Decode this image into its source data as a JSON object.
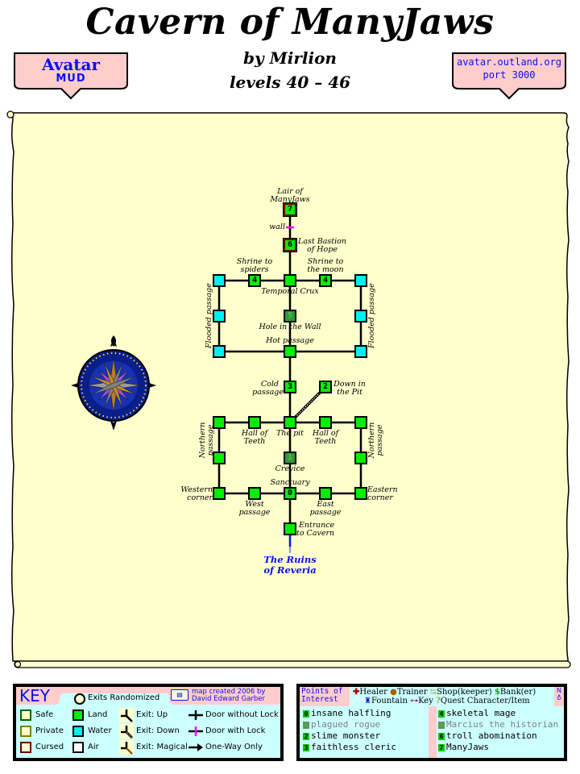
{
  "header": {
    "title": "Cavern of ManyJaws",
    "byline": "by Mirlion",
    "levels": "levels 40 – 46",
    "left_shield": {
      "line1": "Avatar",
      "line2": "MUD",
      "fill": "#ffcccc"
    },
    "right_shield": {
      "line1": "avatar.outland.org",
      "line2": "port 3000",
      "fill": "#ffcccc"
    }
  },
  "colors": {
    "parchment": "#ffffcc",
    "land": "#00ee00",
    "water": "#00f0f0",
    "cursed_border": "#6b0000",
    "door_with_lock": "#ff00ff",
    "exit_label": "#0a10f0",
    "legend_bg": "#ccffff",
    "legend_header": "#ffcccc"
  },
  "map": {
    "rooms": [
      {
        "id": "lair",
        "name": "Lair of ManyJaws",
        "terrain": "land",
        "zone": "cursed",
        "poi": "7"
      },
      {
        "id": "bastion",
        "name": "Last Bastion of Hope",
        "terrain": "land",
        "zone": "cursed",
        "poi": "6"
      },
      {
        "id": "shrine-spiders",
        "name": "Shrine to spiders",
        "terrain": "land",
        "poi": "4"
      },
      {
        "id": "crux",
        "name": "Temporal Crux",
        "terrain": "land"
      },
      {
        "id": "shrine-moon",
        "name": "Shrine to the moon",
        "terrain": "land",
        "poi": "4"
      },
      {
        "id": "flood-w1",
        "name": "",
        "terrain": "water"
      },
      {
        "id": "flood-w2",
        "name": "",
        "terrain": "water"
      },
      {
        "id": "flood-w3",
        "name": "",
        "terrain": "water"
      },
      {
        "id": "flood-e1",
        "name": "",
        "terrain": "water"
      },
      {
        "id": "flood-e2",
        "name": "",
        "terrain": "water"
      },
      {
        "id": "flood-e3",
        "name": "",
        "terrain": "water"
      },
      {
        "id": "hole",
        "name": "Hole in the Wall",
        "terrain": "land",
        "poi": "5",
        "dim": true
      },
      {
        "id": "hot",
        "name": "Hot passage",
        "terrain": "land"
      },
      {
        "id": "cold",
        "name": "Cold passage",
        "terrain": "land",
        "poi": "3"
      },
      {
        "id": "downpit",
        "name": "Down in the Pit",
        "terrain": "land",
        "poi": "2"
      },
      {
        "id": "pit",
        "name": "The pit",
        "terrain": "land"
      },
      {
        "id": "teeth-w",
        "name": "Hall of Teeth",
        "terrain": "land"
      },
      {
        "id": "teeth-e",
        "name": "Hall of Teeth",
        "terrain": "land"
      },
      {
        "id": "nw-corner",
        "name": "",
        "terrain": "land"
      },
      {
        "id": "ne-corner",
        "name": "",
        "terrain": "land"
      },
      {
        "id": "north-w",
        "name": "",
        "terrain": "land"
      },
      {
        "id": "north-e",
        "name": "",
        "terrain": "land"
      },
      {
        "id": "crevice",
        "name": "Crevice",
        "terrain": "land",
        "poi": "1",
        "dim": true
      },
      {
        "id": "western",
        "name": "Western corner",
        "terrain": "land"
      },
      {
        "id": "west",
        "name": "West passage",
        "terrain": "land"
      },
      {
        "id": "sanctuary",
        "name": "Sanctuary",
        "terrain": "land",
        "poi": "0"
      },
      {
        "id": "east",
        "name": "East passage",
        "terrain": "land"
      },
      {
        "id": "eastern",
        "name": "Eastern corner",
        "terrain": "land"
      },
      {
        "id": "entrance",
        "name": "Entrance to Cavern",
        "terrain": "land"
      }
    ],
    "labels": {
      "lair": [
        "Lair of",
        "ManyJaws"
      ],
      "wall": "wall",
      "bastion": [
        "Last Bastion",
        "of Hope"
      ],
      "shrine_spiders": [
        "Shrine to",
        "spiders"
      ],
      "shrine_moon": [
        "Shrine to",
        "the moon"
      ],
      "crux": "Temporal Crux",
      "flooded_w": "Flooded passage",
      "flooded_e": "Flooded passage",
      "hole": "Hole in the Wall",
      "hot": "Hot passage",
      "cold": [
        "Cold",
        "passage"
      ],
      "downpit": [
        "Down in",
        "the Pit"
      ],
      "teeth_w": [
        "Hall of",
        "Teeth"
      ],
      "pit": "The pit",
      "teeth_e": [
        "Hall of",
        "Teeth"
      ],
      "northern_w": [
        "Northern",
        "passage"
      ],
      "northern_e": [
        "Northern",
        "passage"
      ],
      "crevice": "Crevice",
      "sanctuary": "Sanctuary",
      "western": [
        "Western",
        "corner"
      ],
      "west": [
        "West",
        "passage"
      ],
      "east": [
        "East",
        "passage"
      ],
      "eastern": [
        "Eastern",
        "corner"
      ],
      "entrance": [
        "Entrance",
        "to Cavern"
      ],
      "exit_ruins": [
        "The Ruins",
        "of Reveria"
      ]
    }
  },
  "key": {
    "title": "KEY",
    "exits_randomized": "Exits Randomized",
    "credit_line1": "map created 2006 by",
    "credit_line2": "David Edward Garber",
    "zones": [
      "Safe",
      "Private",
      "Cursed"
    ],
    "zone_colors": [
      "#006600",
      "#808000",
      "#6b0000"
    ],
    "terrain": [
      "Land",
      "Water",
      "Air"
    ],
    "terrain_colors": [
      "#00ee00",
      "#00f0f0",
      "#ffffff"
    ],
    "exits": [
      "Exit: Up",
      "Exit: Down",
      "Exit: Magical"
    ],
    "doors": [
      "Door without Lock",
      "Door with Lock",
      "One-Way Only"
    ]
  },
  "poi": {
    "title_line1": "Points of",
    "title_line2": "Interest",
    "symbols_row1": [
      "Healer",
      "Trainer",
      "Shop(keeper)",
      "Bank(er)"
    ],
    "symbols_row2": [
      "Fountain",
      "Key",
      "Quest Character/Item"
    ],
    "north_label": "N",
    "left": [
      {
        "num": "0",
        "name": "insane halfling",
        "dim": false
      },
      {
        "num": "1",
        "name": "plagued rogue",
        "dim": true
      },
      {
        "num": "2",
        "name": "slime monster",
        "dim": false
      },
      {
        "num": "3",
        "name": "faithless cleric",
        "dim": false
      }
    ],
    "right": [
      {
        "num": "4",
        "name": "skeletal mage",
        "dim": false
      },
      {
        "num": "5",
        "name": "Marcius the historian",
        "dim": true
      },
      {
        "num": "6",
        "name": "troll abomination",
        "dim": false
      },
      {
        "num": "7",
        "name": "ManyJaws",
        "dim": false
      }
    ]
  }
}
